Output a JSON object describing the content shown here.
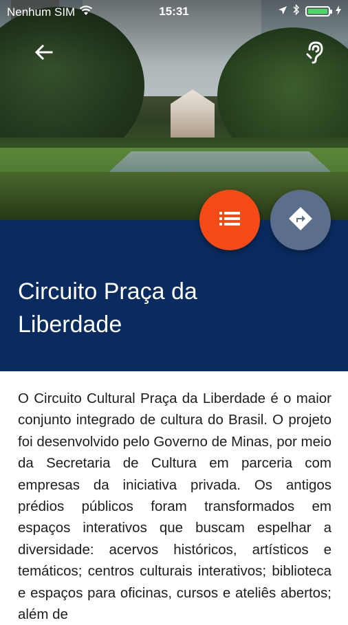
{
  "status_bar": {
    "carrier": "Nenhum SIM",
    "time": "15:31",
    "battery_level": 1.0
  },
  "header": {
    "back_icon": "arrow-left-icon",
    "accessibility_icon": "hearing-icon"
  },
  "actions": {
    "list_icon": "list-icon",
    "directions_icon": "directions-icon",
    "list_color": "#f44a16",
    "directions_color": "#5b6e8c"
  },
  "title": "Circuito Praça da Liberdade",
  "description": "O Circuito Cultural Praça da Liberdade é o maior conjunto integrado de cultura do Brasil. O projeto foi desenvolvido pelo Governo de Minas, por meio da Secretaria de Cultura em parceria com empresas da iniciativa privada. Os antigos prédios públicos foram transformados em espaços interativos que buscam espelhar a diversidade: acervos históricos, artísticos e temáticos; centros culturais interativos; biblioteca e espaços para oficinas, cursos e ateliês abertos; além de",
  "colors": {
    "title_panel": "#0a2b60",
    "text": "#1d1d1d"
  }
}
